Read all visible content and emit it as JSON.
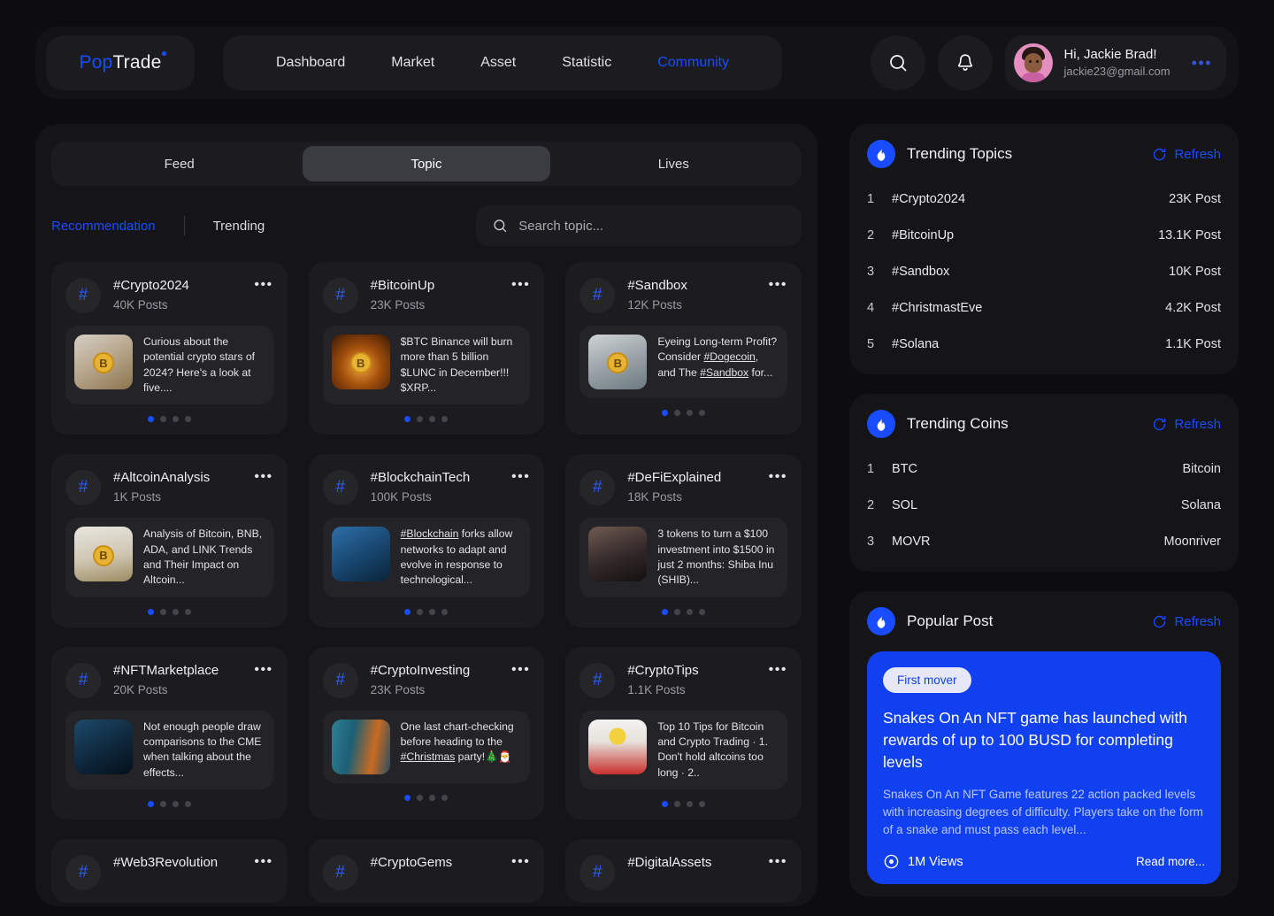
{
  "header": {
    "logo": {
      "part1": "Pop",
      "part2": "Trade"
    },
    "nav": [
      {
        "label": "Dashboard",
        "active": false
      },
      {
        "label": "Market",
        "active": false
      },
      {
        "label": "Asset",
        "active": false
      },
      {
        "label": "Statistic",
        "active": false
      },
      {
        "label": "Community",
        "active": true
      }
    ],
    "search_icon": "search-icon",
    "bell_icon": "bell-icon",
    "profile": {
      "greeting": "Hi, Jackie Brad!",
      "email": "jackie23@gmail.com",
      "more": "•••"
    }
  },
  "main": {
    "segmented_tabs": [
      {
        "label": "Feed",
        "active": false
      },
      {
        "label": "Topic",
        "active": true
      },
      {
        "label": "Lives",
        "active": false
      }
    ],
    "subtabs": [
      {
        "label": "Recommendation",
        "active": true
      },
      {
        "label": "Trending",
        "active": false
      }
    ],
    "search": {
      "placeholder": "Search topic...",
      "value": ""
    },
    "cards": [
      {
        "tag": "#Crypto2024",
        "count": "40K Posts",
        "post_text": "Curious about the potential crypto stars of 2024? Here's a look at five....",
        "thumb": "t-coinhand",
        "thumb_name": "hand-holding-bitcoin-thumbnail",
        "dots": 4,
        "active_dot": 0
      },
      {
        "tag": "#BitcoinUp",
        "count": "23K Posts",
        "post_text": "$BTC Binance will burn more than 5 billion $LUNC in December!!! $XRP...",
        "thumb": "t-btcglow",
        "thumb_name": "bitcoin-network-thumbnail",
        "dots": 4,
        "active_dot": 0
      },
      {
        "tag": "#Sandbox",
        "count": "12K Posts",
        "post_text": "Eyeing Long-term Profit? Consider #Dogecoin, and The #Sandbox for...",
        "thumb": "t-sandbox",
        "thumb_name": "people-on-coin-thumbnail",
        "dots": 4,
        "active_dot": 0
      },
      {
        "tag": "#AltcoinAnalysis",
        "count": "1K Posts",
        "post_text": "Analysis of Bitcoin, BNB, ADA, and LINK Trends and Their Impact on Altcoin...",
        "thumb": "t-chart",
        "thumb_name": "coin-stack-chart-thumbnail",
        "dots": 4,
        "active_dot": 0
      },
      {
        "tag": "#BlockchainTech",
        "count": "100K Posts",
        "post_text": "#Blockchain forks allow networks to adapt and evolve in response to technological...",
        "thumb": "t-blue",
        "thumb_name": "blockchain-city-thumbnail",
        "dots": 4,
        "active_dot": 0
      },
      {
        "tag": "#DeFiExplained",
        "count": "18K Posts",
        "post_text": "3 tokens to turn a $100 investment into $1500 in just 2 months: Shiba Inu (SHIB)...",
        "thumb": "t-phone",
        "thumb_name": "person-with-phone-thumbnail",
        "dots": 4,
        "active_dot": 0
      },
      {
        "tag": "#NFTMarketplace",
        "count": "20K Posts",
        "post_text": "Not enough people draw comparisons to the CME when talking about the effects...",
        "thumb": "t-dark",
        "thumb_name": "hand-touching-screen-thumbnail",
        "dots": 4,
        "active_dot": 0
      },
      {
        "tag": "#CryptoInvesting",
        "count": "23K Posts",
        "post_text": "One last chart-checking before heading to the #Christmas party!🎄🎅",
        "thumb": "t-glitch",
        "thumb_name": "glitch-face-thumbnail",
        "dots": 4,
        "active_dot": 0
      },
      {
        "tag": "#CryptoTips",
        "count": "1.1K Posts",
        "post_text": "Top 10 Tips for Bitcoin and Crypto Trading · 1. Don't hold altcoins too long · 2..",
        "thumb": "t-bulb",
        "thumb_name": "lightbulb-poster-thumbnail",
        "dots": 4,
        "active_dot": 0
      },
      {
        "tag": "#Web3Revolution",
        "count": "",
        "post_text": "",
        "thumb": "t-blue",
        "thumb_name": "web3-thumbnail",
        "dots": 0,
        "active_dot": 0
      },
      {
        "tag": "#CryptoGems",
        "count": "",
        "post_text": "",
        "thumb": "t-chart",
        "thumb_name": "gems-thumbnail",
        "dots": 0,
        "active_dot": 0
      },
      {
        "tag": "#DigitalAssets",
        "count": "",
        "post_text": "",
        "thumb": "t-phone",
        "thumb_name": "digital-assets-thumbnail",
        "dots": 0,
        "active_dot": 0
      }
    ]
  },
  "sidebar": {
    "trending_topics": {
      "title": "Trending Topics",
      "refresh": "Refresh",
      "rows": [
        {
          "rank": "1",
          "label": "#Crypto2024",
          "value": "23K Post"
        },
        {
          "rank": "2",
          "label": "#BitcoinUp",
          "value": "13.1K Post"
        },
        {
          "rank": "3",
          "label": "#Sandbox",
          "value": "10K Post"
        },
        {
          "rank": "4",
          "label": "#ChristmastEve",
          "value": "4.2K Post"
        },
        {
          "rank": "5",
          "label": "#Solana",
          "value": "1.1K Post"
        }
      ]
    },
    "trending_coins": {
      "title": "Trending Coins",
      "refresh": "Refresh",
      "rows": [
        {
          "rank": "1",
          "label": "BTC",
          "value": "Bitcoin"
        },
        {
          "rank": "2",
          "label": "SOL",
          "value": "Solana"
        },
        {
          "rank": "3",
          "label": "MOVR",
          "value": "Moonriver"
        }
      ]
    },
    "popular_post": {
      "title": "Popular Post",
      "refresh": "Refresh",
      "badge": "First mover",
      "headline": "Snakes On An NFT game has launched with rewards of up to 100 BUSD for completing levels",
      "description": "Snakes On An NFT Game features 22 action packed levels with increasing degrees of difficulty. Players take on the form of a snake and must pass each level...",
      "views": "1M Views",
      "read_more": "Read more..."
    }
  },
  "colors": {
    "accent": "#1a4cff",
    "popular_post_bg": "#1040f0",
    "page_bg": "#0d0d10",
    "panel_bg": "#151518",
    "card_bg": "#1c1c20"
  }
}
